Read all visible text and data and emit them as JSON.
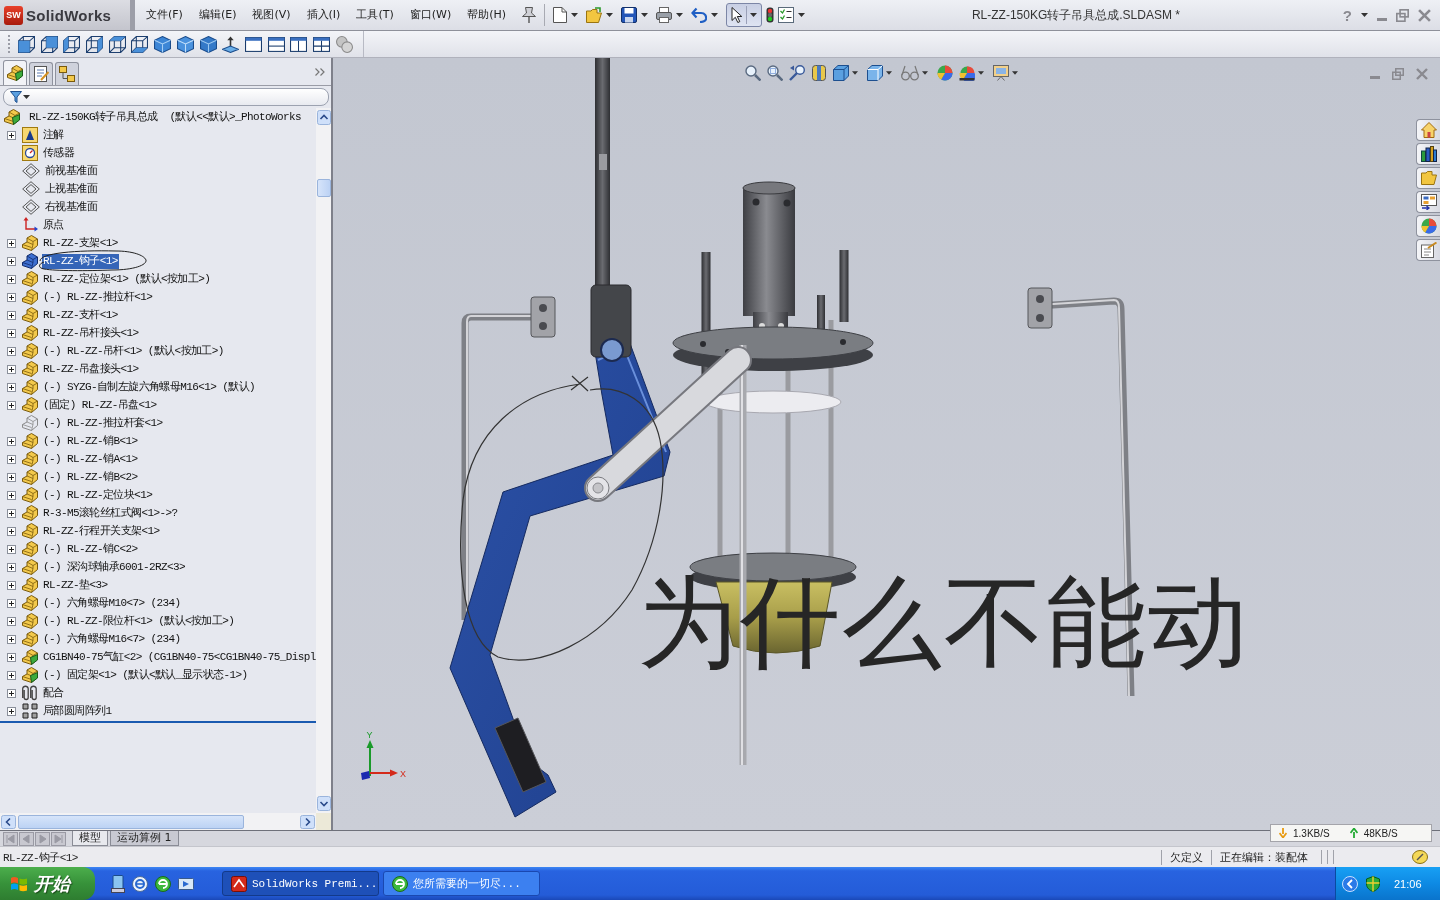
{
  "menubar": {
    "logo": {
      "badge": "SW",
      "name": "SolidWorks"
    },
    "menus": [
      "文件(F)",
      "编辑(E)",
      "视图(V)",
      "插入(I)",
      "工具(T)",
      "窗口(W)",
      "帮助(H)"
    ],
    "select_tool_active": true,
    "title": "RL-ZZ-150KG转子吊具总成.SLDASM *",
    "help": "?"
  },
  "panel_tabs": [
    {
      "selected": true
    },
    {
      "selected": false
    },
    {
      "selected": false
    }
  ],
  "feature_tree": {
    "root": {
      "label": "RL-ZZ-150KG转子吊具总成  (默认<<默认>_PhotoWorks",
      "kind": "assembly",
      "selected": false,
      "children": [
        {
          "label": "注解",
          "kind": "annotations",
          "expandable": true,
          "selected": false
        },
        {
          "label": "传感器",
          "kind": "sensors",
          "expandable": false,
          "selected": false
        },
        {
          "label": "前视基准面",
          "kind": "plane",
          "expandable": false,
          "selected": false
        },
        {
          "label": "上视基准面",
          "kind": "plane",
          "expandable": false,
          "selected": false
        },
        {
          "label": "右视基准面",
          "kind": "plane",
          "expandable": false,
          "selected": false
        },
        {
          "label": "原点",
          "kind": "origin",
          "expandable": false,
          "selected": false
        },
        {
          "label": "RL-ZZ-支架<1>",
          "kind": "part",
          "expandable": true,
          "selected": false,
          "hidden": false
        },
        {
          "label": "RL-ZZ-钩子<1>",
          "kind": "part",
          "expandable": true,
          "selected": true,
          "hidden": false
        },
        {
          "label": "RL-ZZ-定位架<1> (默认<按加工>)",
          "kind": "part",
          "expandable": true,
          "selected": false,
          "hidden": false
        },
        {
          "label": "(-) RL-ZZ-推拉杆<1>",
          "kind": "part",
          "expandable": true,
          "selected": false,
          "hidden": false
        },
        {
          "label": "RL-ZZ-支杆<1>",
          "kind": "part",
          "expandable": true,
          "selected": false,
          "hidden": false
        },
        {
          "label": "RL-ZZ-吊杆接头<1>",
          "kind": "part",
          "expandable": true,
          "selected": false,
          "hidden": false
        },
        {
          "label": "(-) RL-ZZ-吊杆<1> (默认<按加工>)",
          "kind": "part",
          "expandable": true,
          "selected": false,
          "hidden": false
        },
        {
          "label": "RL-ZZ-吊盘接头<1>",
          "kind": "part",
          "expandable": true,
          "selected": false,
          "hidden": false
        },
        {
          "label": "(-) SYZG-自制左旋六角螺母M16<1> (默认)",
          "kind": "part",
          "expandable": true,
          "selected": false,
          "hidden": false
        },
        {
          "label": "(固定) RL-ZZ-吊盘<1>",
          "kind": "part",
          "expandable": true,
          "selected": false,
          "hidden": false
        },
        {
          "label": "(-) RL-ZZ-推拉杆套<1>",
          "kind": "part",
          "expandable": false,
          "selected": false,
          "hidden": true
        },
        {
          "label": "(-) RL-ZZ-销B<1>",
          "kind": "part",
          "expandable": true,
          "selected": false,
          "hidden": false
        },
        {
          "label": "(-) RL-ZZ-销A<1>",
          "kind": "part",
          "expandable": true,
          "selected": false,
          "hidden": false
        },
        {
          "label": "(-) RL-ZZ-销B<2>",
          "kind": "part",
          "expandable": true,
          "selected": false,
          "hidden": false
        },
        {
          "label": "(-) RL-ZZ-定位块<1>",
          "kind": "part",
          "expandable": true,
          "selected": false,
          "hidden": false
        },
        {
          "label": "R-3-M5滚轮丝杠式阀<1>->?",
          "kind": "part",
          "expandable": true,
          "selected": false,
          "hidden": false
        },
        {
          "label": "RL-ZZ-行程开关支架<1>",
          "kind": "part",
          "expandable": true,
          "selected": false,
          "hidden": false
        },
        {
          "label": "(-) RL-ZZ-销C<2>",
          "kind": "part",
          "expandable": true,
          "selected": false,
          "hidden": false
        },
        {
          "label": "(-) 深沟球轴承6001-2RZ<3>",
          "kind": "part",
          "expandable": true,
          "selected": false,
          "hidden": false
        },
        {
          "label": "RL-ZZ-垫<3>",
          "kind": "part",
          "expandable": true,
          "selected": false,
          "hidden": false
        },
        {
          "label": "(-) 六角螺母M10<7> (234)",
          "kind": "part",
          "expandable": true,
          "selected": false,
          "hidden": false
        },
        {
          "label": "(-) RL-ZZ-限位杆<1> (默认<按加工>)",
          "kind": "part",
          "expandable": true,
          "selected": false,
          "hidden": false
        },
        {
          "label": "(-) 六角螺母M16<7> (234)",
          "kind": "part",
          "expandable": true,
          "selected": false,
          "hidden": false
        },
        {
          "label": "CG1BN40-75气缸<2> (CG1BN40-75<CG1BN40-75_Displ",
          "kind": "assembly",
          "expandable": true,
          "selected": false,
          "hidden": false
        },
        {
          "label": "(-) 固定架<1> (默认<默认_显示状态-1>)",
          "kind": "assembly",
          "expandable": true,
          "selected": false,
          "hidden": false
        },
        {
          "label": "配合",
          "kind": "mates",
          "expandable": true,
          "selected": false
        },
        {
          "label": "局部圆周阵列1",
          "kind": "pattern",
          "expandable": true,
          "selected": false
        }
      ]
    }
  },
  "viewport": {
    "handwritten_note": "为什么不能动",
    "triad": {
      "y_label": "Y",
      "x_label": "X"
    }
  },
  "net_speed": {
    "download": "1.3KB/S",
    "upload": "48KB/S"
  },
  "bottom_tabs": [
    {
      "label": "模型",
      "selected": true
    },
    {
      "label": "运动算例 1",
      "selected": false
    }
  ],
  "status_bar": {
    "selection": "RL-ZZ-钩子<1>",
    "fields": [
      "欠定义",
      "正在编辑：装配体"
    ]
  },
  "taskbar": {
    "start": "开始",
    "tasks": [
      {
        "label": "SolidWorks Premi...",
        "selected": true
      },
      {
        "label": "您所需要的一切尽...",
        "selected": false
      }
    ],
    "clock": "21:06"
  }
}
